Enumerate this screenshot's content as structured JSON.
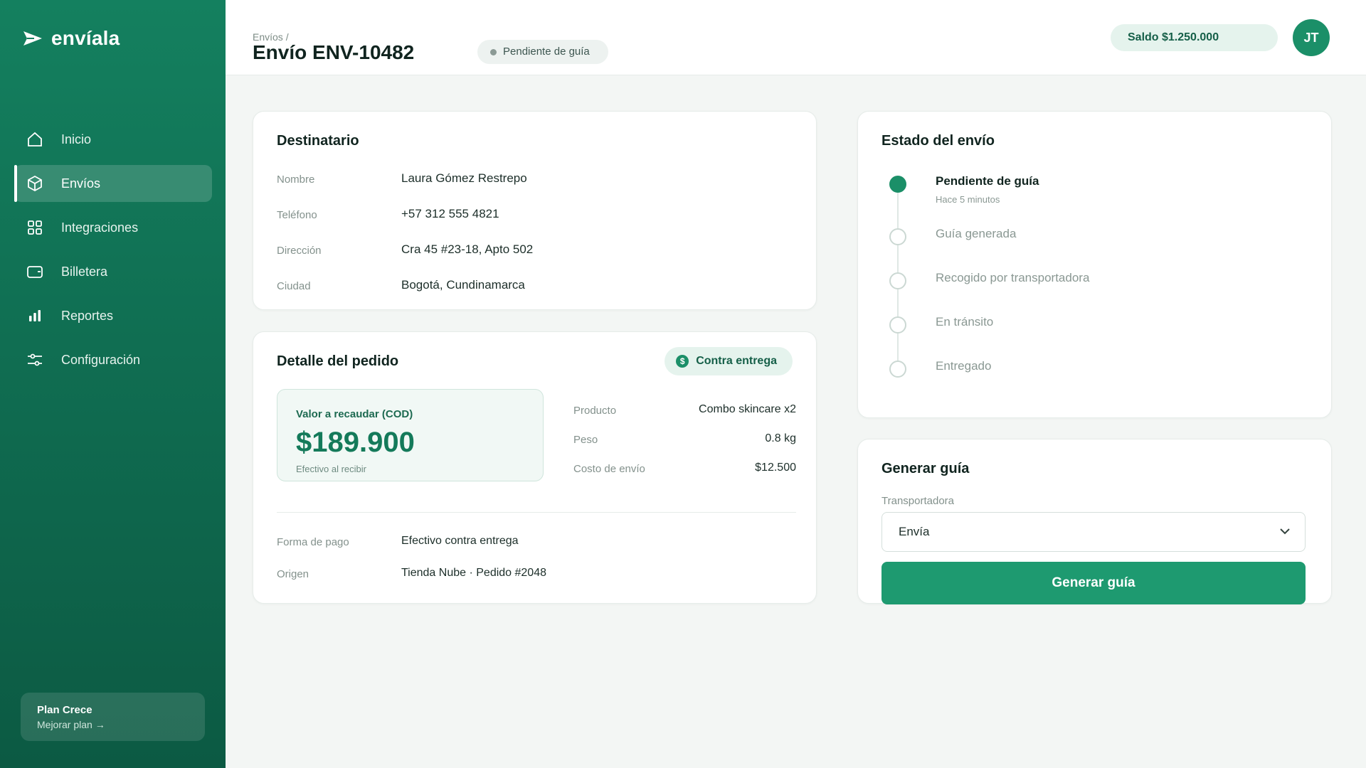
{
  "brand": {
    "name": "envíala"
  },
  "sidebar": {
    "items": [
      {
        "label": "Inicio",
        "icon": "home-icon"
      },
      {
        "label": "Envíos",
        "icon": "package-icon",
        "active": true
      },
      {
        "label": "Integraciones",
        "icon": "grid-icon"
      },
      {
        "label": "Billetera",
        "icon": "wallet-icon"
      },
      {
        "label": "Reportes",
        "icon": "bar-chart-icon"
      },
      {
        "label": "Configuración",
        "icon": "sliders-icon"
      }
    ],
    "plan": {
      "title": "Plan Crece",
      "link": "Mejorar plan →"
    }
  },
  "header": {
    "breadcrumb": "Envíos /",
    "title": "Envío ENV-10482",
    "status": "Pendiente de guía",
    "balance": "Saldo $1.250.000",
    "avatar_initials": "JT"
  },
  "recipient": {
    "title": "Destinatario",
    "fields": [
      {
        "label": "Nombre",
        "value": "Laura Gómez Restrepo"
      },
      {
        "label": "Teléfono",
        "value": "+57 312 555 4821"
      },
      {
        "label": "Dirección",
        "value": "Cra 45 #23-18, Apto 502"
      },
      {
        "label": "Ciudad",
        "value": "Bogotá, Cundinamarca"
      }
    ]
  },
  "order": {
    "title": "Detalle del pedido",
    "chip": "Contra entrega",
    "chip_icon_glyph": "$",
    "cod": {
      "label": "Valor a recaudar (COD)",
      "value": "$189.900",
      "note": "Efectivo al recibir"
    },
    "details": [
      {
        "label": "Producto",
        "value": "Combo skincare x2"
      },
      {
        "label": "Peso",
        "value": "0.8 kg"
      },
      {
        "label": "Costo de envío",
        "value": "$12.500"
      }
    ],
    "extra": [
      {
        "label": "Forma de pago",
        "value": "Efectivo contra entrega"
      },
      {
        "label": "Origen",
        "value": "Tienda Nube · Pedido #2048"
      }
    ]
  },
  "state": {
    "title": "Estado del envío",
    "steps": [
      {
        "label": "Pendiente de guía",
        "sub": "Hace 5 minutos",
        "done": true
      },
      {
        "label": "Guía generada",
        "sub": ""
      },
      {
        "label": "Recogido por transportadora",
        "sub": ""
      },
      {
        "label": "En tránsito",
        "sub": ""
      },
      {
        "label": "Entregado",
        "sub": ""
      }
    ]
  },
  "guide": {
    "title": "Generar guía",
    "carrier_label": "Transportadora",
    "carrier_value": "Envía",
    "button": "Generar guía"
  },
  "colors": {
    "accent": "#1e9a70",
    "sidebar": "#0f6a4f",
    "chip_bg": "#e5f3ed"
  }
}
